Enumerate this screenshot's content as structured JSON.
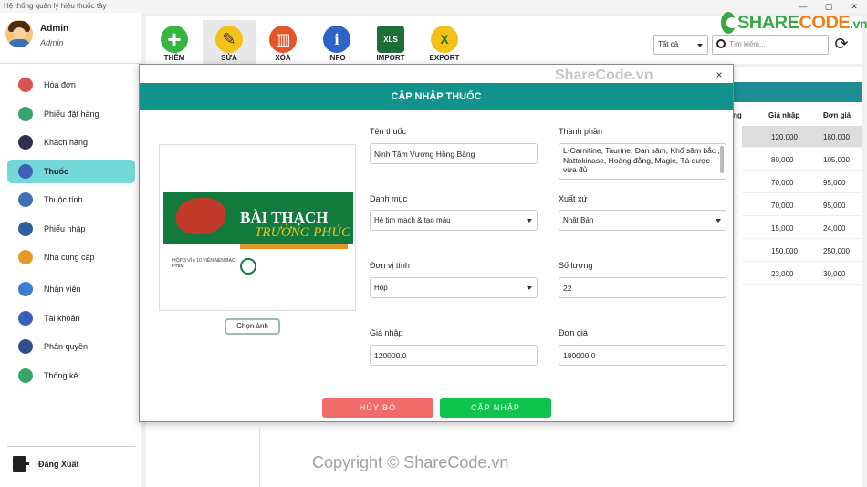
{
  "window": {
    "title": "Hệ thống quản lý hiệu thuốc tây",
    "controls": [
      "—",
      "▢",
      "✕"
    ]
  },
  "profile": {
    "name": "Admin",
    "role": "Admin"
  },
  "sidebar": {
    "items": [
      {
        "label": "Hóa đơn",
        "icon": "invoice-icon",
        "color": "#d9534f"
      },
      {
        "label": "Phiếu đặt hàng",
        "icon": "order-form-icon",
        "color": "#3aa56b"
      },
      {
        "label": "Khách hàng",
        "icon": "customer-icon",
        "color": "#2f2f4f"
      },
      {
        "label": "Thuốc",
        "icon": "pill-icon",
        "color": "#3f5fb8",
        "active": true
      },
      {
        "label": "Thuộc tính",
        "icon": "attribute-icon",
        "color": "#3f6fb8"
      },
      {
        "label": "Phiếu nhập",
        "icon": "import-form-icon",
        "color": "#2f5f9f"
      },
      {
        "label": "Nhà cung cấp",
        "icon": "supplier-icon",
        "color": "#e39b2a"
      },
      {
        "label": "Nhân viên",
        "icon": "employee-icon",
        "color": "#3a7fd0"
      },
      {
        "label": "Tài khoản",
        "icon": "account-icon",
        "color": "#3a5fb8"
      },
      {
        "label": "Phân quyền",
        "icon": "permission-icon",
        "color": "#2f4f8f"
      },
      {
        "label": "Thống kê",
        "icon": "statistics-icon",
        "color": "#3aa56b"
      }
    ],
    "logout_label": "Đăng Xuất"
  },
  "toolbar": {
    "buttons": [
      {
        "label": "THÊM",
        "icon": "add-icon",
        "color": "#36b540",
        "glyph": "+"
      },
      {
        "label": "SỬA",
        "icon": "edit-icon",
        "color": "#f2c21a",
        "glyph": "✎",
        "active": true
      },
      {
        "label": "XÓA",
        "icon": "delete-icon",
        "color": "#e4532a",
        "glyph": "▥"
      },
      {
        "label": "INFO",
        "icon": "info-icon",
        "color": "#2e63c9",
        "glyph": "i"
      },
      {
        "label": "IMPORT",
        "icon": "import-icon",
        "color": "#1f6e3a",
        "glyph": "XLS"
      },
      {
        "label": "EXPORT",
        "icon": "export-icon",
        "color": "#f2c21a",
        "glyph": "X"
      }
    ],
    "filter_value": "Tất cả",
    "search_placeholder": "Tìm kiếm..."
  },
  "logo": {
    "part1": "SHARE",
    "part2": "CODE",
    "suffix": ".vn"
  },
  "table": {
    "columns": [
      "ng",
      "Giá nhập",
      "Đơn giá"
    ],
    "rows": [
      {
        "gia_nhap": "120,000",
        "don_gia": "180,000",
        "selected": true
      },
      {
        "gia_nhap": "80,000",
        "don_gia": "105,000"
      },
      {
        "gia_nhap": "70,000",
        "don_gia": "95,000"
      },
      {
        "gia_nhap": "70,000",
        "don_gia": "95,000"
      },
      {
        "gia_nhap": "15,000",
        "don_gia": "24,000"
      },
      {
        "gia_nhap": "150,000",
        "don_gia": "250,000"
      },
      {
        "gia_nhap": "23,000",
        "don_gia": "30,000"
      }
    ]
  },
  "modal": {
    "title": "CẬP NHẬP THUỐC",
    "close": "×",
    "choose_image_label": "Chọn ảnh",
    "product_image": {
      "title": "BÀI THẠCH",
      "subtitle": "TRƯỜNG PHÚC",
      "small_text": "HỘP 3 VỈ x 10 VIÊN NÉN BAO PHIM"
    },
    "fields": {
      "ten_thuoc": {
        "label": "Tên thuốc",
        "value": "Ninh Tâm Vương Hồng Bàng"
      },
      "thanh_phan": {
        "label": "Thành phần",
        "value": "L-Carnitine, Taurine, Đan sâm, Khổ sâm bắc , Nattokinase, Hoàng đằng, Magie, Tá dược vừa đủ"
      },
      "danh_muc": {
        "label": "Danh mục",
        "value": "Hệ tim mạch & tạo máu"
      },
      "xuat_xu": {
        "label": "Xuất xứ",
        "value": "Nhật Bản"
      },
      "don_vi_tinh": {
        "label": "Đơn vị tính",
        "value": "Hộp"
      },
      "so_luong": {
        "label": "Số lượng",
        "value": "22"
      },
      "gia_nhap": {
        "label": "Giá nhập",
        "value": "120000.0"
      },
      "don_gia": {
        "label": "Đơn giá",
        "value": "180000.0"
      }
    },
    "cancel_label": "HỦY BỎ",
    "update_label": "CẬP NHẬP"
  },
  "watermarks": {
    "top": "ShareCode.vn",
    "bottom": "Copyright © ShareCode.vn"
  }
}
